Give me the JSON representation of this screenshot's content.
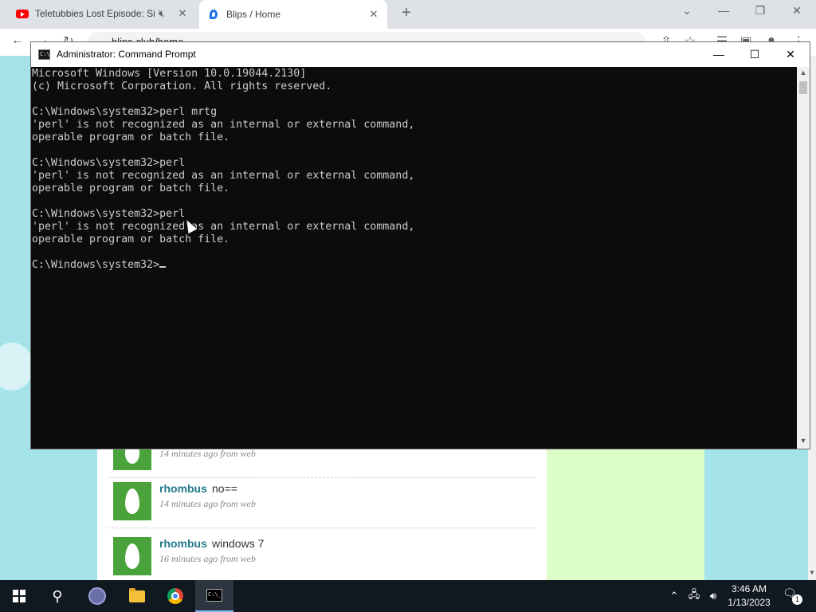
{
  "browser": {
    "tabs": [
      {
        "title": "Teletubbies Lost Episode: Sile",
        "favicon": "youtube-icon"
      },
      {
        "title": "Blips / Home",
        "favicon": "blips-icon"
      }
    ],
    "url": "blips.club/home"
  },
  "page": {
    "posts": [
      {
        "user": "",
        "message": "",
        "meta": "14 minutes ago from web"
      },
      {
        "user": "rhombus",
        "message": "no==",
        "meta": "14 minutes ago from web"
      },
      {
        "user": "rhombus",
        "message": "windows 7",
        "meta": "16 minutes ago from web"
      }
    ]
  },
  "cmd": {
    "title": "Administrator:  Command Prompt",
    "lines": [
      "Microsoft Windows [Version 10.0.19044.2130]",
      "(c) Microsoft Corporation. All rights reserved.",
      "",
      "C:\\Windows\\system32>perl mrtg",
      "'perl' is not recognized as an internal or external command,",
      "operable program or batch file.",
      "",
      "C:\\Windows\\system32>perl",
      "'perl' is not recognized as an internal or external command,",
      "operable program or batch file.",
      "",
      "C:\\Windows\\system32>perl",
      "'perl' is not recognized as an internal or external command,",
      "operable program or batch file.",
      ""
    ],
    "prompt": "C:\\Windows\\system32>"
  },
  "taskbar": {
    "time": "3:46 AM",
    "date": "1/13/2023",
    "notifications": "1"
  },
  "colors": {
    "console_bg": "#0c0c0c",
    "console_text": "#cccccc",
    "taskbar_bg": "#101820",
    "page_bg": "#a5e3ea",
    "sidebar_bg": "#ddfdc8",
    "username": "#227a8a"
  }
}
